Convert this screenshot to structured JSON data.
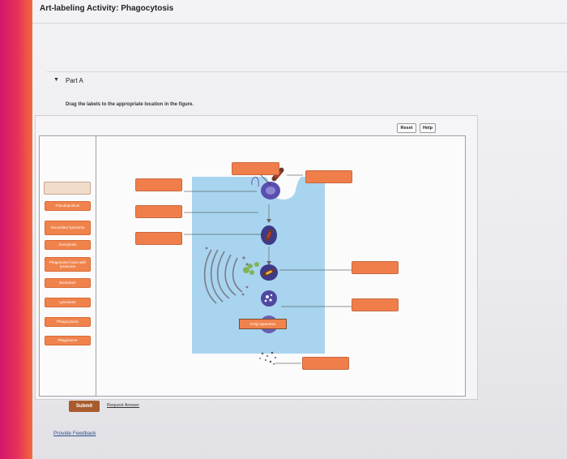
{
  "header": {
    "title": "Art-labeling Activity: Phagocytosis"
  },
  "part": {
    "label": "Part A"
  },
  "instruction": "Drag the labels to the appropriate location in the figure.",
  "toolbar": {
    "reset_label": "Reset",
    "help_label": "Help"
  },
  "label_bank": [
    {
      "text": "Pseudopodium"
    },
    {
      "text": "Secondary lysosome"
    },
    {
      "text": "Exocytosis"
    },
    {
      "text": "Phagosome fuses with lysosome"
    },
    {
      "text": "Bacterium"
    },
    {
      "text": "Lysosome"
    },
    {
      "text": "Phagocytosis"
    },
    {
      "text": "Phagosome"
    }
  ],
  "figure": {
    "golgi_label": "Golgi apparatus"
  },
  "actions": {
    "submit_label": "Submit",
    "request_answer_label": "Request Answer"
  },
  "footer": {
    "feedback_label": "Provide Feedback"
  },
  "colors": {
    "label_orange": "#f0834c",
    "cell_blue": "#a9d4ef",
    "submit_brown": "#a85b2c"
  }
}
